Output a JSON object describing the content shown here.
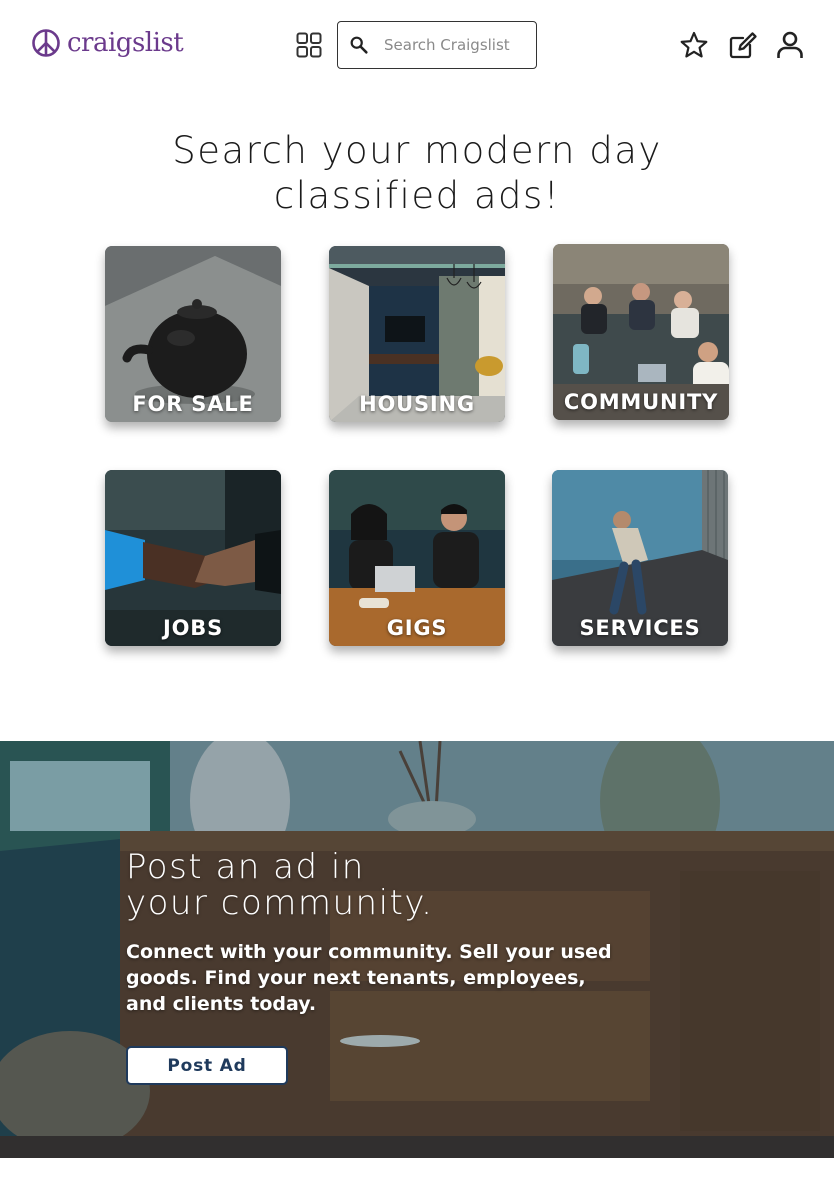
{
  "header": {
    "logo_text": "craigslist",
    "search_placeholder": "Search Craigslist",
    "icons": [
      "peace-sign-icon",
      "grid-icon",
      "search-icon",
      "star-icon",
      "edit-icon",
      "user-icon"
    ]
  },
  "hero": {
    "title_line1": "Search your modern day",
    "title_line2": "classified ads!"
  },
  "categories": [
    {
      "label": "FOR SALE"
    },
    {
      "label": "HOUSING"
    },
    {
      "label": "COMMUNITY"
    },
    {
      "label": "JOBS"
    },
    {
      "label": "GIGS"
    },
    {
      "label": "SERVICES"
    }
  ],
  "banner": {
    "title_line1": "Post an ad in",
    "title_line2": "your community.",
    "subtitle": "Connect with your community. Sell your used goods. Find your next tenants, employees, and clients today.",
    "button_label": "Post Ad"
  },
  "colors": {
    "brand_purple": "#6b3a8c",
    "button_navy": "#1f3a5c"
  }
}
